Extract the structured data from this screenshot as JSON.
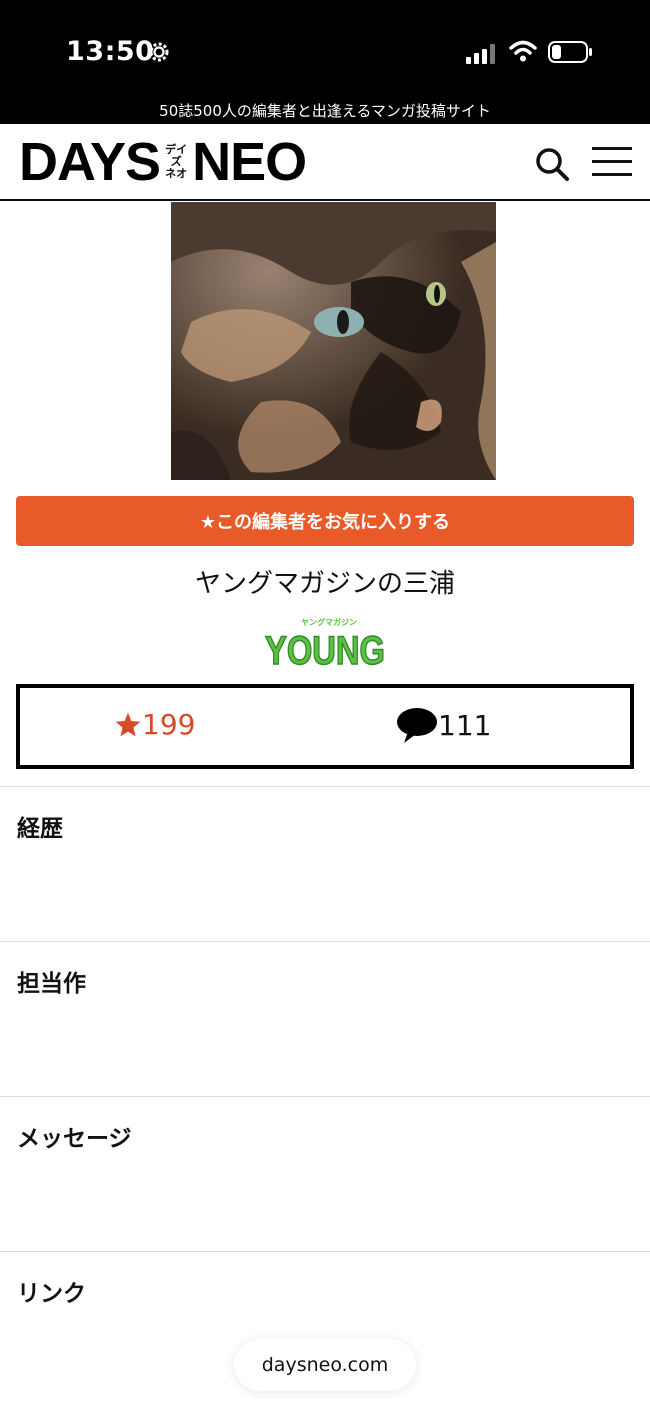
{
  "status_bar": {
    "time": "13:50"
  },
  "tagline": "50誌500人の編集者と出逢えるマンガ投稿サイト",
  "header": {
    "logo_left": "DAYS",
    "logo_kana_top": "デイズ",
    "logo_kana_bottom": "ネオ",
    "logo_right": "NEO"
  },
  "profile": {
    "favorite_button": "★この編集者をお気に入りする",
    "editor_name": "ヤングマガジンの三浦",
    "magazine_logo_text": "YOUNG",
    "magazine_logo_kana": "ヤングマガジン"
  },
  "stats": {
    "favorites": "199",
    "comments": "111"
  },
  "sections": [
    {
      "title": "経歴"
    },
    {
      "title": "担当作"
    },
    {
      "title": "メッセージ"
    },
    {
      "title": "リンク"
    }
  ],
  "browser": {
    "url": "daysneo.com"
  },
  "colors": {
    "accent": "#e85a28",
    "star": "#d94a2a",
    "magazine_green": "#5cc040"
  }
}
